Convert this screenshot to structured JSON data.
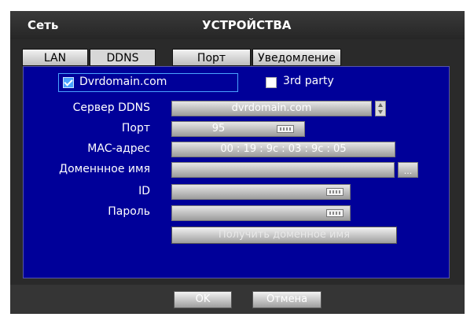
{
  "title_bar": {
    "left": "Сеть",
    "title": "УСТРОЙСТВА"
  },
  "tabs": [
    {
      "label": "LAN"
    },
    {
      "label": "DDNS"
    },
    {
      "label": "Порт"
    },
    {
      "label": "Уведомление"
    }
  ],
  "ddns": {
    "provider_checkbox": {
      "label": "Dvrdomain.com",
      "checked": true
    },
    "third_party_checkbox": {
      "label": "3rd party",
      "checked": false
    },
    "server": {
      "label": "Сервер DDNS",
      "value": "dvrdomain.com"
    },
    "port": {
      "label": "Порт",
      "value": "95"
    },
    "mac": {
      "label": "MAC-адрес",
      "value": "00 : 19 : 9c : 03 : 9c : 05"
    },
    "domain": {
      "label": "Доменнное имя",
      "value": "",
      "browse": "..."
    },
    "id": {
      "label": "ID",
      "value": ""
    },
    "password": {
      "label": "Пароль",
      "value": ""
    },
    "get_domain_button": "Получить доменное имя"
  },
  "footer": {
    "ok": "OK",
    "cancel": "Отмена"
  },
  "colors": {
    "panel": "#000099",
    "accent": "#4aa3ff"
  }
}
